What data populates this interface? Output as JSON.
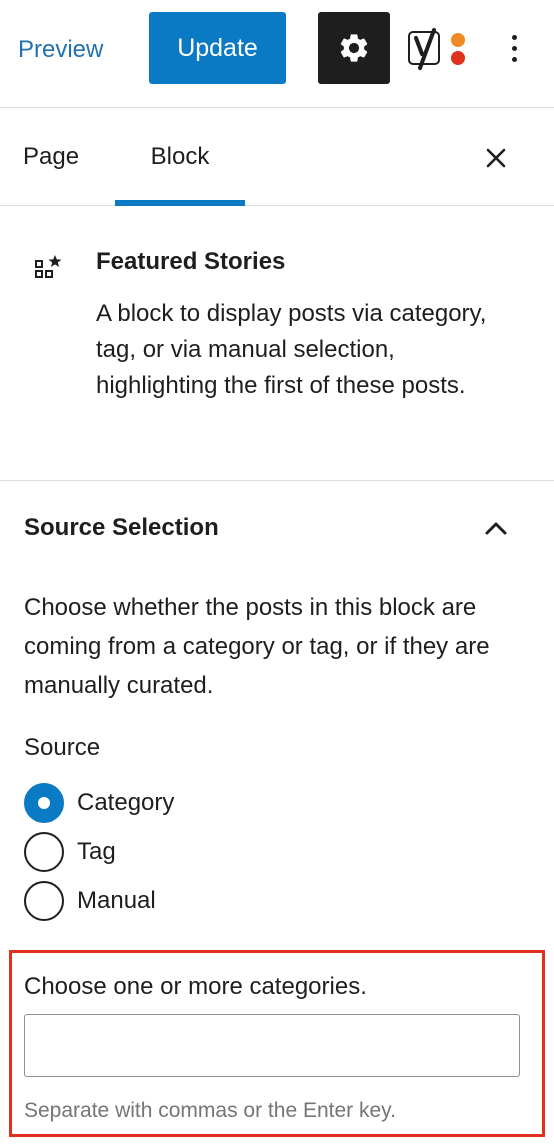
{
  "toolbar": {
    "preview_label": "Preview",
    "update_label": "Update",
    "settings_icon": "gear-icon",
    "yoast_icon": "yoast-icon",
    "more_icon": "more-vertical-icon",
    "colors": {
      "primary": "#0a7ac4",
      "dark": "#1e1e1e",
      "link": "#2271b1"
    }
  },
  "tabs": [
    {
      "label": "Page",
      "active": false
    },
    {
      "label": "Block",
      "active": true
    }
  ],
  "block": {
    "title": "Featured Stories",
    "description": "A block to display posts via category, tag, or via manual selection, highlighting the first of these posts."
  },
  "source_panel": {
    "title": "Source Selection",
    "help": "Choose whether the posts in this block are coming from a category or tag, or if they are manually curated.",
    "source_label": "Source",
    "options": [
      {
        "label": "Category",
        "checked": true
      },
      {
        "label": "Tag",
        "checked": false
      },
      {
        "label": "Manual",
        "checked": false
      }
    ]
  },
  "categories_field": {
    "label": "Choose one or more categories.",
    "value": "",
    "help": "Separate with commas or the Enter key.",
    "highlight_color": "#e0301e"
  }
}
